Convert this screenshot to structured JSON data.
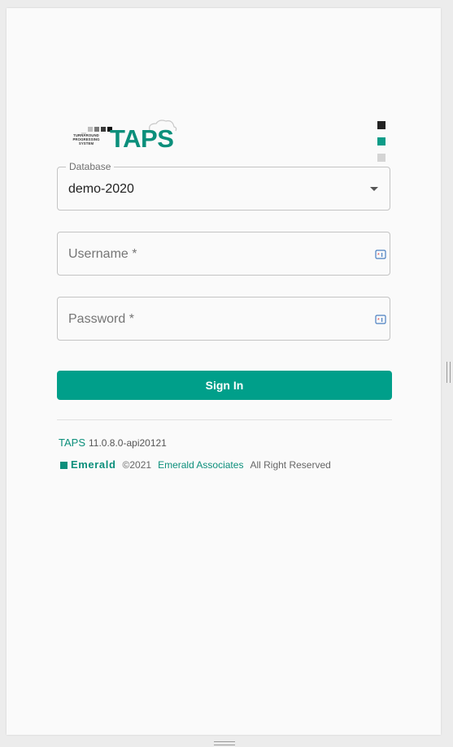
{
  "logo": {
    "small_text": [
      "TURNAROUND",
      "PROGRESSING",
      "SYSTEM"
    ],
    "big_text": "TAPS"
  },
  "brand_dots": [
    "#222222",
    "#0b9c88",
    "#d4d4d4"
  ],
  "database": {
    "legend": "Database",
    "value": "demo-2020"
  },
  "username": {
    "placeholder": "Username *"
  },
  "password": {
    "placeholder": "Password *"
  },
  "signin_label": "Sign In",
  "version": {
    "app": "TAPS",
    "number": "11.0.8.0-api20121"
  },
  "footer": {
    "brand": "Emerald",
    "copyright": "©2021",
    "company": "Emerald Associates",
    "rights": "All Right Reserved"
  },
  "colors": {
    "accent": "#009f8a",
    "brand_green": "#0b8f7b"
  }
}
